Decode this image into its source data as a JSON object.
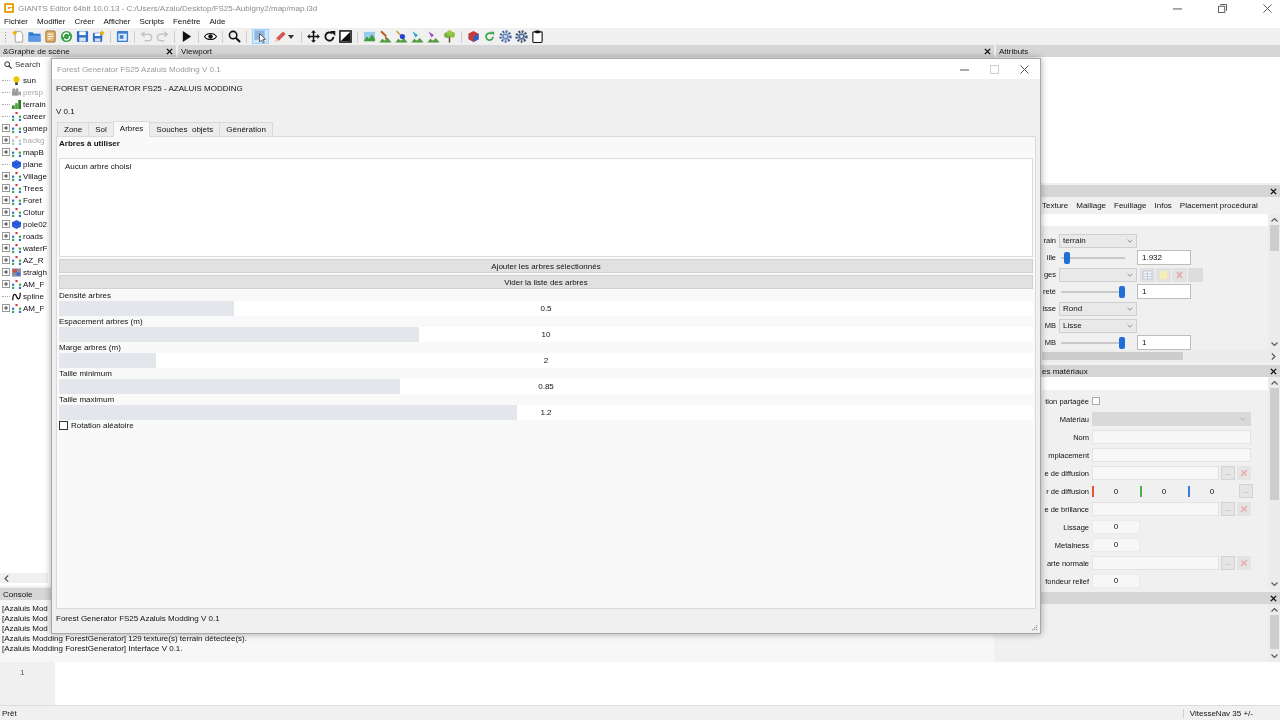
{
  "window": {
    "title": "GIANTS Editor 64bit 10.0.13 - C:/Users/Azalu/Desktop/FS25-Aubigny2/map/map.i3d"
  },
  "menu": [
    "Fichier",
    "Modifier",
    "Créer",
    "Afficher",
    "Scripts",
    "Fenêtre",
    "Aide"
  ],
  "toolbar": {
    "history_buttons": [
      {
        "disabled": true
      },
      {
        "disabled": true
      }
    ],
    "mode_buttons": [
      {
        "selected": true
      },
      {
        "selected": false
      }
    ]
  },
  "scene_graph": {
    "title": "&Graphe de scène",
    "search": {
      "placeholder": "Search"
    },
    "items": [
      {
        "label": "sun",
        "kind": "light",
        "expander": false,
        "dimmed": false
      },
      {
        "label": "persp",
        "kind": "camera",
        "expander": false,
        "dimmed": true
      },
      {
        "label": "terrain",
        "kind": "terrain",
        "expander": false,
        "dimmed": false
      },
      {
        "label": "career",
        "kind": "group",
        "expander": false,
        "dimmed": false
      },
      {
        "label": "gamep",
        "kind": "group",
        "expander": true,
        "dimmed": false
      },
      {
        "label": "backg",
        "kind": "group",
        "expander": true,
        "dimmed": true
      },
      {
        "label": "mapB",
        "kind": "group",
        "expander": true,
        "dimmed": false
      },
      {
        "label": "plane",
        "kind": "shape",
        "expander": false,
        "dimmed": false
      },
      {
        "label": "Village",
        "kind": "group",
        "expander": true,
        "dimmed": false
      },
      {
        "label": "Trees",
        "kind": "group",
        "expander": true,
        "dimmed": false
      },
      {
        "label": "Foret",
        "kind": "group",
        "expander": true,
        "dimmed": false
      },
      {
        "label": "Clotur",
        "kind": "group",
        "expander": true,
        "dimmed": false
      },
      {
        "label": "pole02",
        "kind": "shape",
        "expander": true,
        "dimmed": false
      },
      {
        "label": "roads",
        "kind": "group",
        "expander": true,
        "dimmed": false
      },
      {
        "label": "waterF",
        "kind": "group",
        "expander": true,
        "dimmed": false
      },
      {
        "label": "AZ_R",
        "kind": "group",
        "expander": true,
        "dimmed": false
      },
      {
        "label": "straigh",
        "kind": "mesh",
        "expander": true,
        "dimmed": false
      },
      {
        "label": "AM_F",
        "kind": "group",
        "expander": true,
        "dimmed": false
      },
      {
        "label": "spline",
        "kind": "spline",
        "expander": false,
        "dimmed": false
      },
      {
        "label": "AM_F",
        "kind": "group",
        "expander": true,
        "dimmed": false
      }
    ]
  },
  "viewport": {
    "title": "Viewport"
  },
  "attributes": {
    "title": "Attributs"
  },
  "shape_panel": {
    "tabs": [
      "Texture",
      "Maillage",
      "Feuillage",
      "Infos",
      "Placement procédural"
    ],
    "rows": [
      {
        "kind": "dropdown",
        "label": "rain",
        "value": "terrain"
      },
      {
        "kind": "slider",
        "label": "ille",
        "level": 0.05,
        "value": "1.932"
      },
      {
        "kind": "dropdown_buttons",
        "label": "ges"
      },
      {
        "kind": "slider",
        "label": "reté",
        "level": 1,
        "value": "1"
      },
      {
        "kind": "dropdown",
        "label": "isse",
        "value": "Rond"
      },
      {
        "kind": "dropdown",
        "label": "MB",
        "value": "Lisse"
      },
      {
        "kind": "slider",
        "label": "MB",
        "level": 1,
        "value": "1"
      }
    ]
  },
  "materials_panel": {
    "title": "es matériaux",
    "rows": [
      {
        "kind": "checkbox",
        "label": "tion partagée",
        "checked": false
      },
      {
        "kind": "dropdown",
        "label": "Matériau",
        "disabled": true
      },
      {
        "kind": "field",
        "label": "Nom"
      },
      {
        "kind": "field",
        "label": "mplacement"
      },
      {
        "kind": "file",
        "label": "e de diffusion",
        "button": "..."
      },
      {
        "kind": "color",
        "label": "r de diffusion",
        "channels": [
          {
            "value": "0",
            "color": "#e0552f"
          },
          {
            "value": "0",
            "color": "#4cb04a"
          },
          {
            "value": "0",
            "color": "#3b7ddd"
          }
        ],
        "button": "..."
      },
      {
        "kind": "file",
        "label": "e de brillance",
        "button": "..."
      },
      {
        "kind": "number",
        "label": "Lissage",
        "value": "0"
      },
      {
        "kind": "number",
        "label": "Metalness",
        "value": "0"
      },
      {
        "kind": "file",
        "label": "arte normale",
        "button": "..."
      },
      {
        "kind": "number",
        "label": "fondeur relief",
        "value": "0"
      }
    ]
  },
  "console": {
    "title": "Console",
    "lines": [
      "[Azaluis Mod",
      "[Azaluis Mod",
      "[Azaluis Mod",
      "[Azaluis Modding ForestGenerator] 129 texture(s) terrain détectée(s).",
      "[Azaluis Modding ForestGenerator] Interface V 0.1."
    ],
    "line_number": "1"
  },
  "status_bar": {
    "message": "Prêt",
    "navigation": "VitesseNav 35 +/-"
  },
  "dialog": {
    "title": "Forest Generator FS25 Azaluis Modding V 0.1",
    "heading": "FOREST GENERATOR FS25 - AZALUIS MODDING",
    "version": "V 0.1",
    "tabs": [
      {
        "label": "Zone",
        "selected": false
      },
      {
        "label": "Sol",
        "selected": false
      },
      {
        "label": "Arbres",
        "selected": true
      },
      {
        "label": "Souches  objets",
        "selected": false
      },
      {
        "label": "Génération",
        "selected": false
      }
    ],
    "section_title": "Arbres à utiliser",
    "list_message": "Aucun arbre choisi",
    "buttons": [
      "Ajouter les arbres sélectionnés",
      "Vider la liste des arbres"
    ],
    "sliders": [
      {
        "label": "Densité arbres",
        "value": "0.5",
        "level": 0.18
      },
      {
        "label": "Espacement arbres (m)",
        "value": "10",
        "level": 0.37
      },
      {
        "label": "Marge arbres (m)",
        "value": "2",
        "level": 0.1
      },
      {
        "label": "Taille minimum",
        "value": "0.85",
        "level": 0.35
      },
      {
        "label": "Taille maximum",
        "value": "1.2",
        "level": 0.47
      }
    ],
    "checkbox": {
      "label": "Rotation aléatoire",
      "checked": false
    },
    "footer": "Forest Generator FS25 Azaluis Modding V 0.1"
  }
}
